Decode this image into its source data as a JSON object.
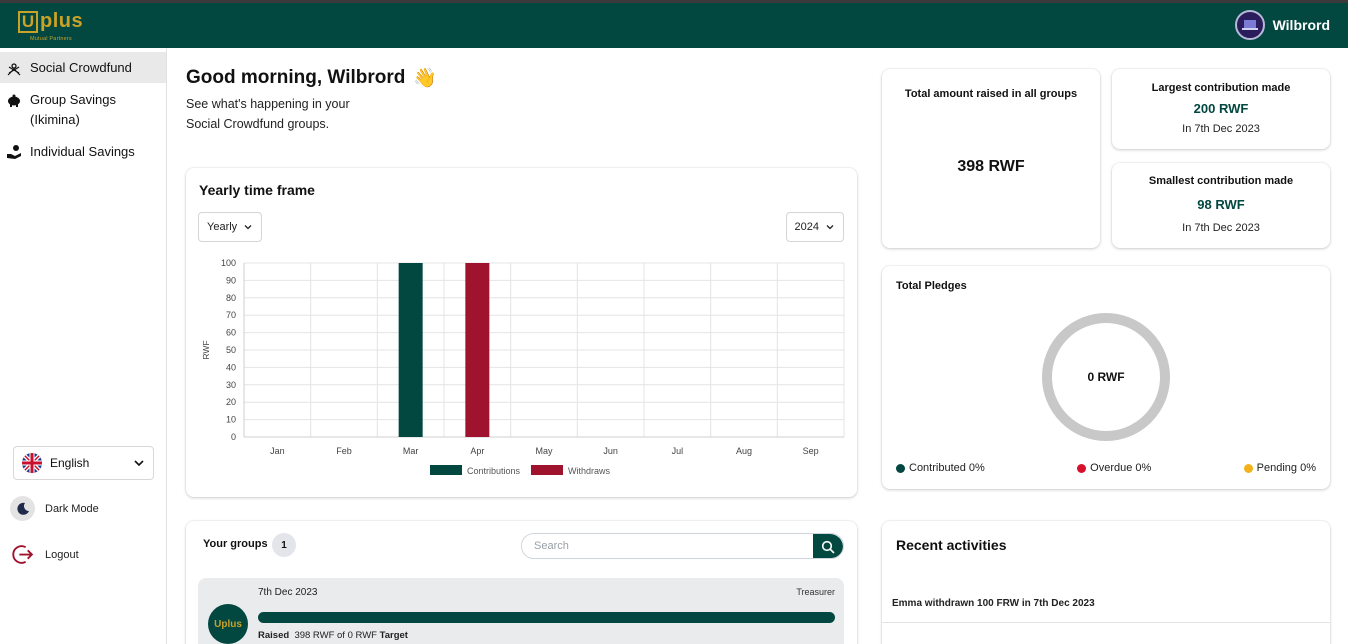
{
  "header": {
    "logo_letter": "U",
    "logo_text": "plus",
    "logo_sub": "Mutual Partners",
    "user_name": "Wilbrord"
  },
  "sidebar": {
    "items": [
      {
        "label": "Social Crowdfund",
        "icon": "crowd-icon",
        "active": true
      },
      {
        "label": "Group Savings (Ikimina)",
        "icon": "piggy-bank-icon",
        "active": false
      },
      {
        "label": "Individual Savings",
        "icon": "hand-coin-icon",
        "active": false
      }
    ],
    "language": "English",
    "dark_mode": "Dark Mode",
    "logout": "Logout"
  },
  "greeting": {
    "title": "Good morning, Wilbrord",
    "emoji": "👋",
    "subtitle": "See what's happening in your Social Crowdfund groups."
  },
  "chart_card": {
    "title": "Yearly time frame",
    "period_select": "Yearly",
    "year_select": "2024"
  },
  "chart_data": {
    "type": "bar",
    "categories": [
      "Jan",
      "Feb",
      "Mar",
      "Apr",
      "May",
      "Jun",
      "Jul",
      "Aug",
      "Sep"
    ],
    "series": [
      {
        "name": "Contributions",
        "color": "#034741",
        "values": [
          0,
          0,
          100,
          0,
          0,
          0,
          0,
          0,
          0
        ]
      },
      {
        "name": "Withdraws",
        "color": "#a0132e",
        "values": [
          0,
          0,
          0,
          100,
          0,
          0,
          0,
          0,
          0
        ]
      }
    ],
    "ylabel": "RWF",
    "ylim": [
      0,
      100
    ],
    "yticks": [
      0,
      10,
      20,
      30,
      40,
      50,
      60,
      70,
      80,
      90,
      100
    ],
    "grid": true,
    "legend": "bottom"
  },
  "stats": {
    "total_label": "Total amount raised in all groups",
    "total_value": "398 RWF",
    "largest_label": "Largest contribution made",
    "largest_value": "200 RWF",
    "largest_date": "In 7th Dec 2023",
    "smallest_label": "Smallest contribution made",
    "smallest_value": "98 RWF",
    "smallest_date": "In 7th Dec 2023"
  },
  "pledges": {
    "title": "Total Pledges",
    "center": "0 RWF",
    "legend": [
      {
        "label": "Contributed 0%",
        "color": "#034741"
      },
      {
        "label": "Overdue 0%",
        "color": "#d8102c"
      },
      {
        "label": "Pending 0%",
        "color": "#f2b21b"
      }
    ]
  },
  "groups": {
    "title": "Your groups",
    "count": "1",
    "search_placeholder": "Search",
    "rows": [
      {
        "date": "7th Dec 2023",
        "role": "Treasurer",
        "raised_label": "Raised",
        "raised_text": "398 RWF of 0  RWF",
        "target_label": "Target",
        "progress": 1.0,
        "avatar_text": "Uplus"
      }
    ]
  },
  "activities": {
    "title": "Recent activities",
    "items": [
      "Emma withdrawn 100 FRW in 7th Dec 2023"
    ]
  },
  "colors": {
    "brand": "#034741",
    "accent_gold": "#c9a227",
    "withdraw": "#a0132e"
  }
}
